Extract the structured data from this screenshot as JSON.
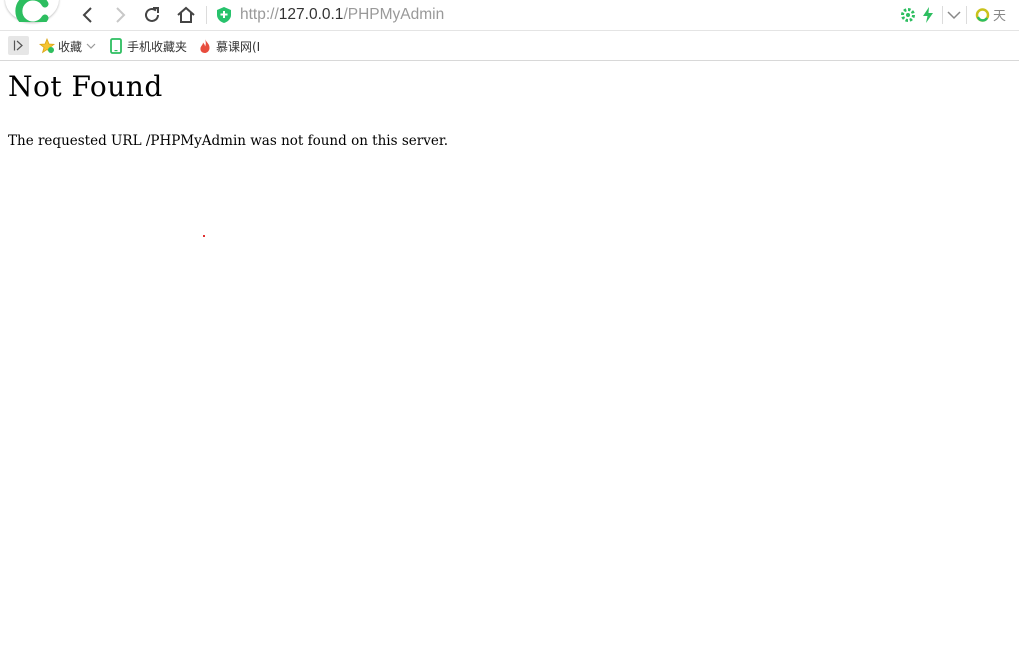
{
  "browser": {
    "address_bar": {
      "scheme": "http://",
      "host": "127.0.0.1",
      "path": "/PHPMyAdmin"
    },
    "search_hint": "天"
  },
  "bookmarks_bar": {
    "items": [
      {
        "label": "收藏",
        "icon": "star-icon"
      },
      {
        "label": "手机收藏夹",
        "icon": "phone-icon"
      },
      {
        "label": "慕课网(I",
        "icon": "flame-icon"
      }
    ]
  },
  "page": {
    "heading": "Not Found",
    "message": "The requested URL /PHPMyAdmin was not found on this server."
  },
  "colors": {
    "accent_green": "#2dbe60",
    "secure_shield": "#27c26c",
    "url_gray": "#999999",
    "url_host": "#333333",
    "flame_red": "#e84c3d"
  }
}
